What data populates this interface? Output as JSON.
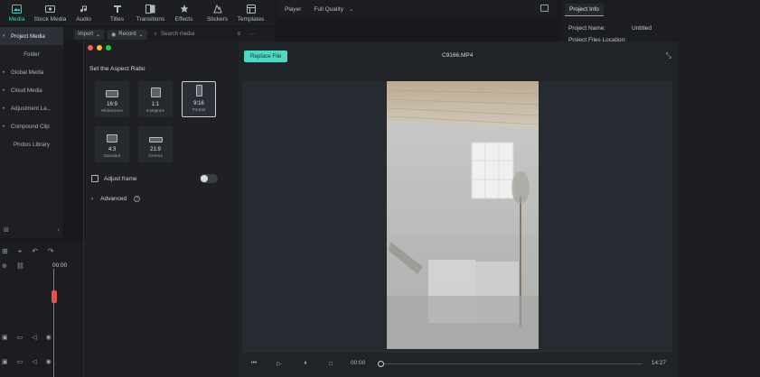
{
  "toolbar": {
    "items": [
      {
        "label": "Media",
        "icon": "media-icon",
        "active": true
      },
      {
        "label": "Stock Media",
        "icon": "stock-media-icon",
        "active": false
      },
      {
        "label": "Audio",
        "icon": "music-note-icon",
        "active": false
      },
      {
        "label": "Titles",
        "icon": "titles-icon",
        "active": false
      },
      {
        "label": "Transitions",
        "icon": "transitions-icon",
        "active": false
      },
      {
        "label": "Effects",
        "icon": "effects-icon",
        "active": false
      },
      {
        "label": "Stickers",
        "icon": "stickers-icon",
        "active": false
      },
      {
        "label": "Templates",
        "icon": "templates-icon",
        "active": false
      }
    ]
  },
  "player": {
    "label": "Player",
    "quality": "Full Quality"
  },
  "project_info": {
    "tab": "Project Info",
    "name_key": "Project Name:",
    "name_value": "Untitled",
    "location_key": "Project Files Location:"
  },
  "subbar": {
    "import": "Import",
    "record": "Record",
    "search_placeholder": "Search media"
  },
  "sidebar": {
    "items": [
      {
        "label": "Project Media",
        "active": true,
        "caret": true
      },
      {
        "label": "Folder",
        "active": false,
        "caret": false
      },
      {
        "label": "Global Media",
        "active": false,
        "caret": true
      },
      {
        "label": "Cloud Media",
        "active": false,
        "caret": true
      },
      {
        "label": "Adjustment La...",
        "active": false,
        "caret": true
      },
      {
        "label": "Compound Clip",
        "active": false,
        "caret": true
      },
      {
        "label": "Photos Library",
        "active": false,
        "caret": false
      }
    ]
  },
  "timeline": {
    "time": "00:00"
  },
  "modal": {
    "aspect_title": "Set the Aspect Ratio",
    "ratios": [
      {
        "ratio": "16:9",
        "name": "Widescreen",
        "selected": false
      },
      {
        "ratio": "1:1",
        "name": "Instagram",
        "selected": false
      },
      {
        "ratio": "9:16",
        "name": "Portrait",
        "selected": true
      },
      {
        "ratio": "4:3",
        "name": "Standard",
        "selected": false
      },
      {
        "ratio": "21:9",
        "name": "Cinema",
        "selected": false
      }
    ],
    "adjust_frame": "Adjust frame",
    "advanced": "Advanced",
    "replace_button": "Replace File",
    "clip_name": "C9166.MP4",
    "current_time": "00:00",
    "total_time": "14:27",
    "progress": 0.0
  },
  "colors": {
    "accent": "#34d4c1",
    "button": "#4fd7c4",
    "playhead": "#e35151"
  }
}
